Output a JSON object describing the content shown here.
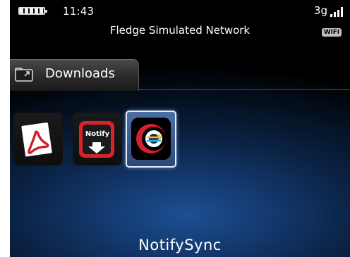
{
  "status_bar": {
    "time": "11:43",
    "network_name": "Fledge Simulated Network",
    "signal_label": "3g",
    "wifi_label": "WiFi"
  },
  "folder": {
    "name": "Downloads"
  },
  "apps": [
    {
      "icon": "adobe-reader-icon"
    },
    {
      "icon": "notify-download-icon",
      "badge_text": "Notify"
    },
    {
      "icon": "notifysync-icon"
    }
  ],
  "selected_app": {
    "label": "NotifySync"
  },
  "colors": {
    "background_glow": "#1d4f93",
    "reader_red": "#cf2027",
    "notify_red": "#d8232a",
    "selection_border": "#e8eef8"
  }
}
